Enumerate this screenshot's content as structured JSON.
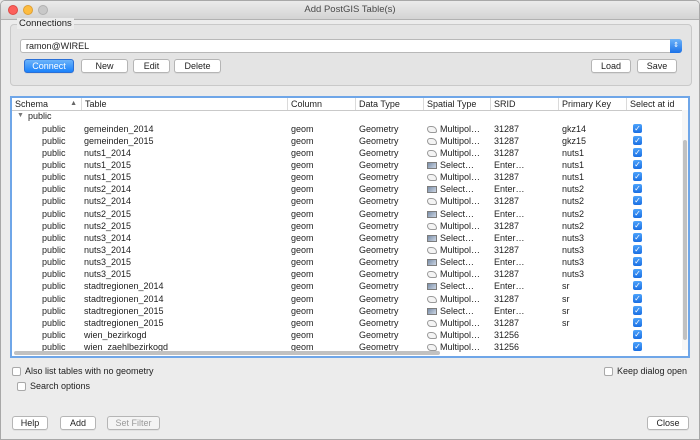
{
  "window": {
    "title": "Add PostGIS Table(s)"
  },
  "connections": {
    "group_title": "Connections",
    "selected_connection": "ramon@WIREL",
    "buttons": {
      "connect": "Connect",
      "new": "New",
      "edit": "Edit",
      "delete": "Delete",
      "load": "Load",
      "save": "Save"
    }
  },
  "table": {
    "headers": [
      "Schema",
      "Table",
      "Column",
      "Data Type",
      "Spatial Type",
      "SRID",
      "Primary Key",
      "Select at id"
    ],
    "group_label": "public",
    "rows": [
      {
        "schema": "public",
        "table": "gemeinden_2014",
        "column": "geom",
        "data_type": "Geometry",
        "spatial_type": "Multipol…",
        "spatial_icon": "polygon-icon",
        "srid": "31287",
        "pk": "gkz14",
        "checked": true
      },
      {
        "schema": "public",
        "table": "gemeinden_2015",
        "column": "geom",
        "data_type": "Geometry",
        "spatial_type": "Multipol…",
        "spatial_icon": "polygon-icon",
        "srid": "31287",
        "pk": "gkz15",
        "checked": true
      },
      {
        "schema": "public",
        "table": "nuts1_2014",
        "column": "geom",
        "data_type": "Geometry",
        "spatial_type": "Multipol…",
        "spatial_icon": "polygon-icon",
        "srid": "31287",
        "pk": "nuts1",
        "checked": true
      },
      {
        "schema": "public",
        "table": "nuts1_2015",
        "column": "geom",
        "data_type": "Geometry",
        "spatial_type": "Select…",
        "spatial_icon": "select-icon",
        "srid": "Enter…",
        "pk": "nuts1",
        "checked": true
      },
      {
        "schema": "public",
        "table": "nuts1_2015",
        "column": "geom",
        "data_type": "Geometry",
        "spatial_type": "Multipol…",
        "spatial_icon": "polygon-icon",
        "srid": "31287",
        "pk": "nuts1",
        "checked": true
      },
      {
        "schema": "public",
        "table": "nuts2_2014",
        "column": "geom",
        "data_type": "Geometry",
        "spatial_type": "Select…",
        "spatial_icon": "select-icon",
        "srid": "Enter…",
        "pk": "nuts2",
        "checked": true
      },
      {
        "schema": "public",
        "table": "nuts2_2014",
        "column": "geom",
        "data_type": "Geometry",
        "spatial_type": "Multipol…",
        "spatial_icon": "polygon-icon",
        "srid": "31287",
        "pk": "nuts2",
        "checked": true
      },
      {
        "schema": "public",
        "table": "nuts2_2015",
        "column": "geom",
        "data_type": "Geometry",
        "spatial_type": "Select…",
        "spatial_icon": "select-icon",
        "srid": "Enter…",
        "pk": "nuts2",
        "checked": true
      },
      {
        "schema": "public",
        "table": "nuts2_2015",
        "column": "geom",
        "data_type": "Geometry",
        "spatial_type": "Multipol…",
        "spatial_icon": "polygon-icon",
        "srid": "31287",
        "pk": "nuts2",
        "checked": true
      },
      {
        "schema": "public",
        "table": "nuts3_2014",
        "column": "geom",
        "data_type": "Geometry",
        "spatial_type": "Select…",
        "spatial_icon": "select-icon",
        "srid": "Enter…",
        "pk": "nuts3",
        "checked": true
      },
      {
        "schema": "public",
        "table": "nuts3_2014",
        "column": "geom",
        "data_type": "Geometry",
        "spatial_type": "Multipol…",
        "spatial_icon": "polygon-icon",
        "srid": "31287",
        "pk": "nuts3",
        "checked": true
      },
      {
        "schema": "public",
        "table": "nuts3_2015",
        "column": "geom",
        "data_type": "Geometry",
        "spatial_type": "Select…",
        "spatial_icon": "select-icon",
        "srid": "Enter…",
        "pk": "nuts3",
        "checked": true
      },
      {
        "schema": "public",
        "table": "nuts3_2015",
        "column": "geom",
        "data_type": "Geometry",
        "spatial_type": "Multipol…",
        "spatial_icon": "polygon-icon",
        "srid": "31287",
        "pk": "nuts3",
        "checked": true
      },
      {
        "schema": "public",
        "table": "stadtregionen_2014",
        "column": "geom",
        "data_type": "Geometry",
        "spatial_type": "Select…",
        "spatial_icon": "select-icon",
        "srid": "Enter…",
        "pk": "sr",
        "checked": true
      },
      {
        "schema": "public",
        "table": "stadtregionen_2014",
        "column": "geom",
        "data_type": "Geometry",
        "spatial_type": "Multipol…",
        "spatial_icon": "polygon-icon",
        "srid": "31287",
        "pk": "sr",
        "checked": true
      },
      {
        "schema": "public",
        "table": "stadtregionen_2015",
        "column": "geom",
        "data_type": "Geometry",
        "spatial_type": "Select…",
        "spatial_icon": "select-icon",
        "srid": "Enter…",
        "pk": "sr",
        "checked": true
      },
      {
        "schema": "public",
        "table": "stadtregionen_2015",
        "column": "geom",
        "data_type": "Geometry",
        "spatial_type": "Multipol…",
        "spatial_icon": "polygon-icon",
        "srid": "31287",
        "pk": "sr",
        "checked": true
      },
      {
        "schema": "public",
        "table": "wien_bezirkogd",
        "column": "geom",
        "data_type": "Geometry",
        "spatial_type": "Multipol…",
        "spatial_icon": "polygon-icon",
        "srid": "31256",
        "pk": "",
        "checked": true
      },
      {
        "schema": "public",
        "table": "wien_zaehlbezirkogd",
        "column": "geom",
        "data_type": "Geometry",
        "spatial_type": "Multipol…",
        "spatial_icon": "polygon-icon",
        "srid": "31256",
        "pk": "",
        "checked": true
      }
    ]
  },
  "options": {
    "no_geometry": "Also list tables with no geometry",
    "search_options": "Search options",
    "keep_open": "Keep dialog open"
  },
  "footer": {
    "help": "Help",
    "add": "Add",
    "set_filter": "Set Filter",
    "close": "Close"
  },
  "colors": {
    "accent": "#1a82fb",
    "focus_border": "#6fa6e8"
  }
}
